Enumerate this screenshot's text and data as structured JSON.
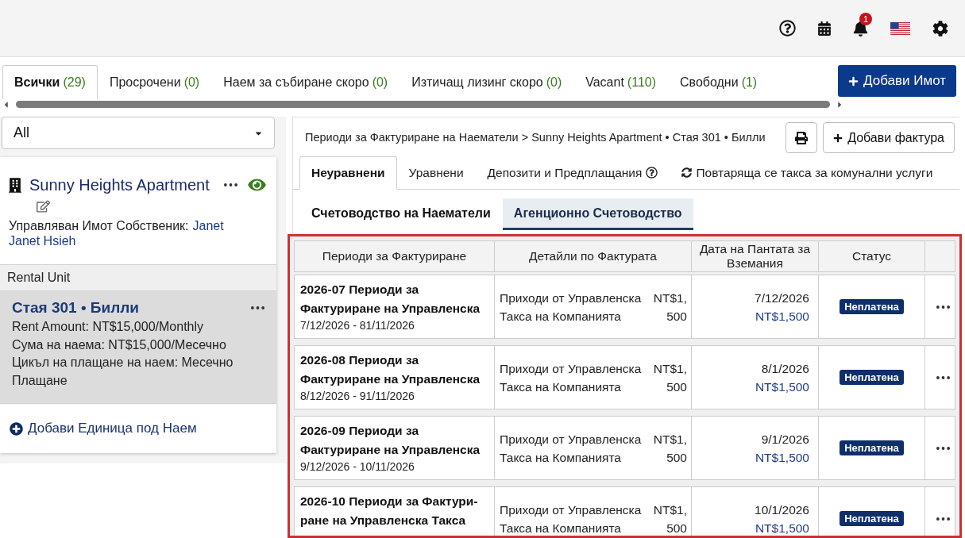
{
  "header": {
    "notification_count": "1"
  },
  "property_tabs": [
    {
      "label": "Всички",
      "count": "(29)",
      "selected": true
    },
    {
      "label": "Просрочени",
      "count": "(0)",
      "selected": false
    },
    {
      "label": "Наем за събиране скоро",
      "count": "(0)",
      "selected": false
    },
    {
      "label": "Изтичащ лизинг скоро",
      "count": "(0)",
      "selected": false
    },
    {
      "label": "Vacant",
      "count": "(110)",
      "selected": false
    },
    {
      "label": "Свободни",
      "count": "(1)",
      "selected": false
    }
  ],
  "add_property_button": "Добави Имот",
  "sidebar": {
    "filter": {
      "value": "All"
    },
    "property": {
      "name": "Sunny Heights Apartment",
      "owner_label": "Управляван Имот Собственик:",
      "owner_links": [
        "Janet",
        "Janet Hsieh"
      ]
    },
    "section_title": "Rental Unit",
    "units": [
      {
        "title": "Стая 301 • Билли",
        "selected": true,
        "details": [
          "Rent Amount: NT$15,000/Monthly",
          "Сума на наема: NT$15,000/Месечно",
          "Цикъл на плащане на наем: Месечно Плащане"
        ]
      }
    ],
    "add_unit": "Добави Единица под Наем"
  },
  "invoice_panel": {
    "breadcrumb": "Периоди за Фактуриране на Наематели > Sunny Heights Apartment • Стая 301 • Билли",
    "add_invoice_button": "Добави фактура",
    "tabs": [
      {
        "label": "Неуравнени",
        "selected": true,
        "kind": "plain"
      },
      {
        "label": "Уравнени",
        "selected": false,
        "kind": "plain"
      },
      {
        "label": "Депозити и Предплащания",
        "selected": false,
        "kind": "help"
      },
      {
        "label": "Повтаряща се такса за комунални услуги",
        "selected": false,
        "kind": "recurring"
      }
    ],
    "sub_tabs": [
      {
        "label": "Счетоводство на Наематели",
        "selected": false
      },
      {
        "label": "Агенционно Счетоводство",
        "selected": true
      }
    ],
    "table": {
      "highlighted": true,
      "columns": [
        "Периоди за Фактуриране",
        "Детайли по Фактурата",
        "Дата на Пантата за Вземания",
        "Статус"
      ],
      "rows": [
        {
          "period": "2026-07 Периоди за Фактуриране на Управленска",
          "date_range": "7/12/2026 - 81/11/2026",
          "detail": "Приходи от Управленска Такса на Компанията",
          "detail_amount": "NT$1,500",
          "due_date": "7/12/2026",
          "due_amount": "NT$1,500",
          "status": "Неплатена"
        },
        {
          "period": "2026-08 Периоди за Фактуриране на Управленска",
          "date_range": "8/12/2026 - 91/11/2026",
          "detail": "Приходи от Управленска Такса на Компанията",
          "detail_amount": "NT$1,500",
          "due_date": "8/1/2026",
          "due_amount": "NT$1,500",
          "status": "Неплатена"
        },
        {
          "period": "2026-09 Периоди за Фактуриране на Управленска",
          "date_range": "9/12/2026 - 10/11/2026",
          "detail": "Приходи от Управленска Такса на Компанията",
          "detail_amount": "NT$1,500",
          "due_date": "9/1/2026",
          "due_amount": "NT$1,500",
          "status": "Неплатена"
        },
        {
          "period": "2026-10 Периоди за Фактури-ране на Управленска Такса",
          "detail": "Приходи от Управленска Такса на Компанията",
          "detail_amount": "NT$1,500",
          "due_date": "10/1/2026",
          "due_amount": "NT$1,500",
          "status": "Неплатена"
        }
      ]
    }
  }
}
